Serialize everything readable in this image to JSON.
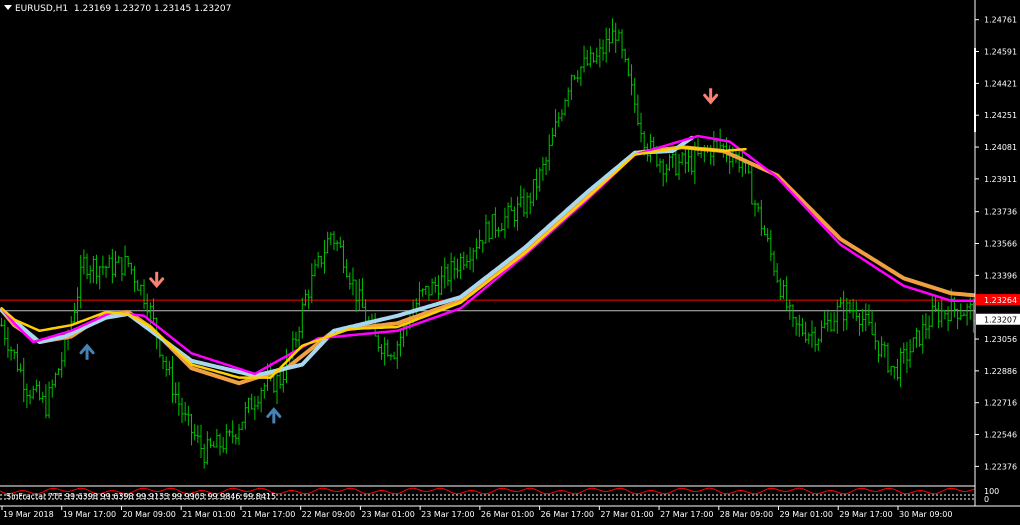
{
  "header": {
    "symbol_timeframe": "EURUSD,H1",
    "ohlc": "1.23169 1.23270 1.23145 1.23207"
  },
  "indicator_label": "SinFractal 7TF  99.6398  99.6398  99.9133  99.9903  99.9846  99.8415",
  "colors": {
    "background": "#000000",
    "bars": "#00c000",
    "ma_light_blue": "#a8d8f0",
    "ma_yellow": "#ffd000",
    "ma_orange": "#f0a040",
    "ma_magenta": "#ff00ff",
    "hline_red": "#ff0000",
    "hline_grey": "#c0c0c0",
    "arrow_up": "#4682b4",
    "arrow_down": "#fa8072",
    "current_price_bg": "#ffffff",
    "red_level_bg": "#ff0000"
  },
  "price_axis": {
    "labels": [
      "1.24761",
      "1.24591",
      "1.24421",
      "1.24251",
      "1.24081",
      "1.23911",
      "1.23736",
      "1.23566",
      "1.23396",
      "1.23056",
      "1.22886",
      "1.22716",
      "1.22546",
      "1.22376"
    ],
    "current_price": "1.23207",
    "red_level": "1.23264"
  },
  "time_axis": {
    "labels": [
      "19 Mar 2018",
      "19 Mar 17:00",
      "20 Mar 09:00",
      "21 Mar 01:00",
      "21 Mar 17:00",
      "22 Mar 09:00",
      "23 Mar 01:00",
      "23 Mar 17:00",
      "26 Mar 01:00",
      "26 Mar 17:00",
      "27 Mar 01:00",
      "27 Mar 17:00",
      "28 Mar 09:00",
      "29 Mar 01:00",
      "29 Mar 17:00",
      "30 Mar 09:00"
    ]
  },
  "arrows": [
    {
      "type": "up",
      "icon": "up-arrow-icon",
      "time": "19 Mar 15:00",
      "price": 1.2302
    },
    {
      "type": "down",
      "icon": "down-arrow-icon",
      "time": "20 Mar 10:00",
      "price": 1.2334
    },
    {
      "type": "up",
      "icon": "up-arrow-icon",
      "time": "21 Mar 18:00",
      "price": 1.2268
    },
    {
      "type": "down",
      "icon": "down-arrow-icon",
      "time": "28 Mar 06:00",
      "price": 1.2432
    }
  ],
  "chart_data": {
    "type": "line",
    "title": "EURUSD,H1",
    "ylim": [
      1.2225,
      1.2485
    ],
    "grid": false,
    "series": [
      {
        "anchors": [
          [
            0,
            1.2321
          ],
          [
            4,
            1.2313
          ],
          [
            12,
            1.2304
          ],
          [
            22,
            1.2307
          ],
          [
            33,
            1.2319
          ],
          [
            40,
            1.232
          ],
          [
            47,
            1.2312
          ],
          [
            60,
            1.229
          ],
          [
            75,
            1.2282
          ],
          [
            90,
            1.229
          ],
          [
            105,
            1.231
          ],
          [
            125,
            1.2314
          ],
          [
            145,
            1.2326
          ],
          [
            165,
            1.2352
          ],
          [
            185,
            1.2382
          ],
          [
            200,
            1.2405
          ],
          [
            215,
            1.2408
          ],
          [
            228,
            1.2406
          ],
          [
            245,
            1.2393
          ],
          [
            265,
            1.2359
          ],
          [
            285,
            1.2338
          ],
          [
            300,
            1.233
          ],
          [
            307,
            1.2329
          ]
        ]
      },
      {
        "anchors": [
          [
            0,
            1.2321
          ],
          [
            12,
            1.2304
          ],
          [
            20,
            1.2307
          ],
          [
            33,
            1.2317
          ],
          [
            40,
            1.2319
          ],
          [
            60,
            1.2294
          ],
          [
            80,
            1.2286
          ],
          [
            95,
            1.2292
          ],
          [
            105,
            1.231
          ],
          [
            125,
            1.2318
          ],
          [
            145,
            1.2328
          ],
          [
            165,
            1.2354
          ],
          [
            185,
            1.2384
          ],
          [
            200,
            1.2405
          ],
          [
            212,
            1.2406
          ],
          [
            218,
            1.2413
          ]
        ]
      },
      {
        "anchors": [
          [
            0,
            1.2322
          ],
          [
            4,
            1.2314
          ],
          [
            10,
            1.2304
          ],
          [
            22,
            1.231
          ],
          [
            35,
            1.232
          ],
          [
            45,
            1.2318
          ],
          [
            60,
            1.2298
          ],
          [
            80,
            1.2287
          ],
          [
            100,
            1.2306
          ],
          [
            125,
            1.231
          ],
          [
            145,
            1.2322
          ],
          [
            165,
            1.235
          ],
          [
            185,
            1.238
          ],
          [
            200,
            1.2404
          ],
          [
            220,
            1.2414
          ],
          [
            230,
            1.2411
          ],
          [
            245,
            1.2392
          ],
          [
            265,
            1.2356
          ],
          [
            285,
            1.2334
          ],
          [
            300,
            1.2326
          ],
          [
            307,
            1.2326
          ]
        ]
      },
      {
        "anchors": [
          [
            0,
            1.2322
          ],
          [
            4,
            1.2316
          ],
          [
            12,
            1.231
          ],
          [
            22,
            1.2313
          ],
          [
            33,
            1.232
          ],
          [
            40,
            1.2319
          ],
          [
            47,
            1.2312
          ],
          [
            60,
            1.2292
          ],
          [
            75,
            1.2285
          ],
          [
            85,
            1.2285
          ],
          [
            95,
            1.2302
          ],
          [
            110,
            1.2311
          ],
          [
            125,
            1.2312
          ],
          [
            145,
            1.2325
          ],
          [
            165,
            1.2351
          ],
          [
            185,
            1.2381
          ],
          [
            200,
            1.2404
          ],
          [
            215,
            1.2408
          ],
          [
            228,
            1.2406
          ],
          [
            235,
            1.2407
          ]
        ]
      }
    ]
  }
}
